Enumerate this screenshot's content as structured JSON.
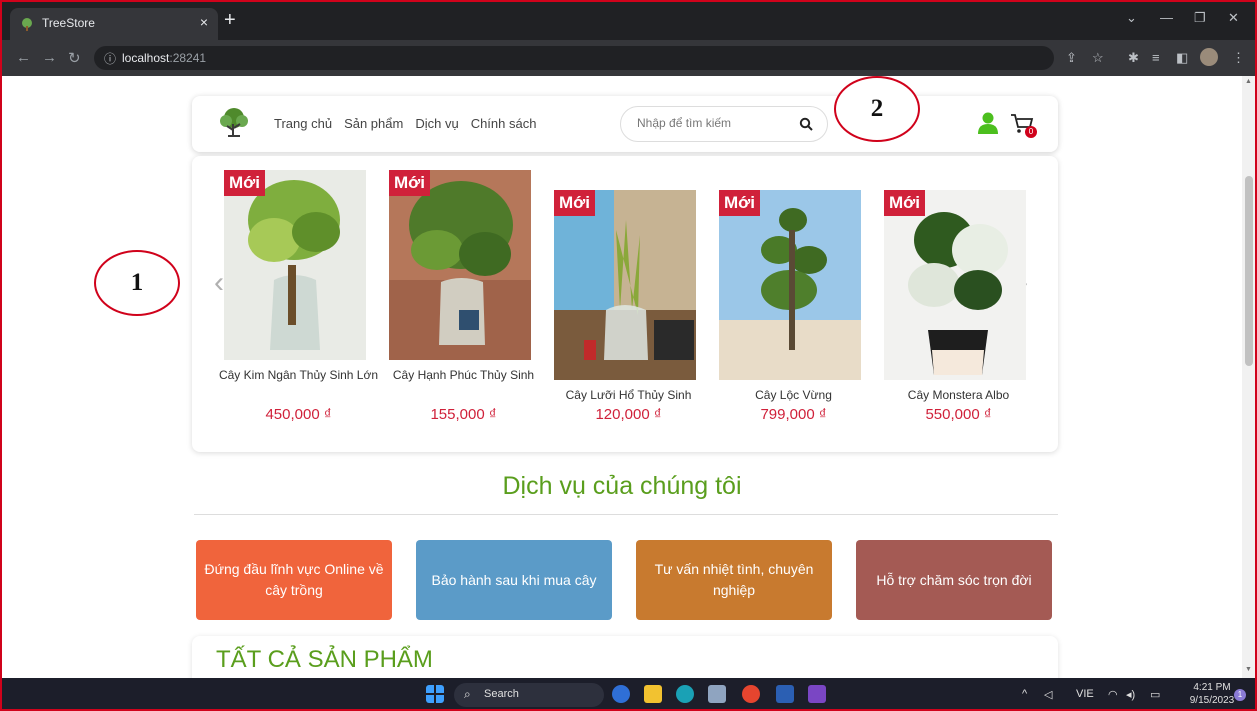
{
  "browser": {
    "tab_title": "TreeStore",
    "tab_close": "×",
    "new_tab": "+",
    "url_host": "localhost",
    "url_port": ":28241"
  },
  "header": {
    "nav": [
      "Trang chủ",
      "Sản phẩm",
      "Dịch vụ",
      "Chính sách"
    ],
    "search_placeholder": "Nhập để tìm kiếm",
    "cart_count": "0"
  },
  "products": [
    {
      "badge": "Mới",
      "name": "Cây Kim Ngân Thủy Sinh Lớn",
      "price": "450,000 ₫"
    },
    {
      "badge": "Mới",
      "name": "Cây Hạnh Phúc Thủy Sinh",
      "price": "155,000 ₫"
    },
    {
      "badge": "Mới",
      "name": "Cây Lưỡi Hổ Thủy Sinh",
      "price": "120,000 ₫"
    },
    {
      "badge": "Mới",
      "name": "Cây Lộc Vừng",
      "price": "799,000 ₫"
    },
    {
      "badge": "Mới",
      "name": "Cây Monstera Albo",
      "price": "550,000 ₫"
    }
  ],
  "services": {
    "title": "Dịch vụ của chúng tôi",
    "items": [
      {
        "label": "Đứng đầu lĩnh vực Online về cây trồng",
        "color": "#f0643c"
      },
      {
        "label": "Bảo hành sau khi mua cây",
        "color": "#5b9bc8"
      },
      {
        "label": "Tư vấn nhiệt tình, chuyên nghiệp",
        "color": "#c87a2f"
      },
      {
        "label": "Hỗ trợ chăm sóc trọn đời",
        "color": "#a45a54"
      }
    ]
  },
  "all_products_title": "TẤT CẢ SẢN PHẨM",
  "annotations": [
    "1",
    "2"
  ],
  "taskbar": {
    "search_label": "Search",
    "language": "VIE",
    "time": "4:21 PM",
    "date": "9/15/2023",
    "notification_count": "1"
  },
  "colors": {
    "accent_green": "#5a9e1d",
    "price_red": "#d0213a",
    "frame_red": "#d0021b"
  }
}
